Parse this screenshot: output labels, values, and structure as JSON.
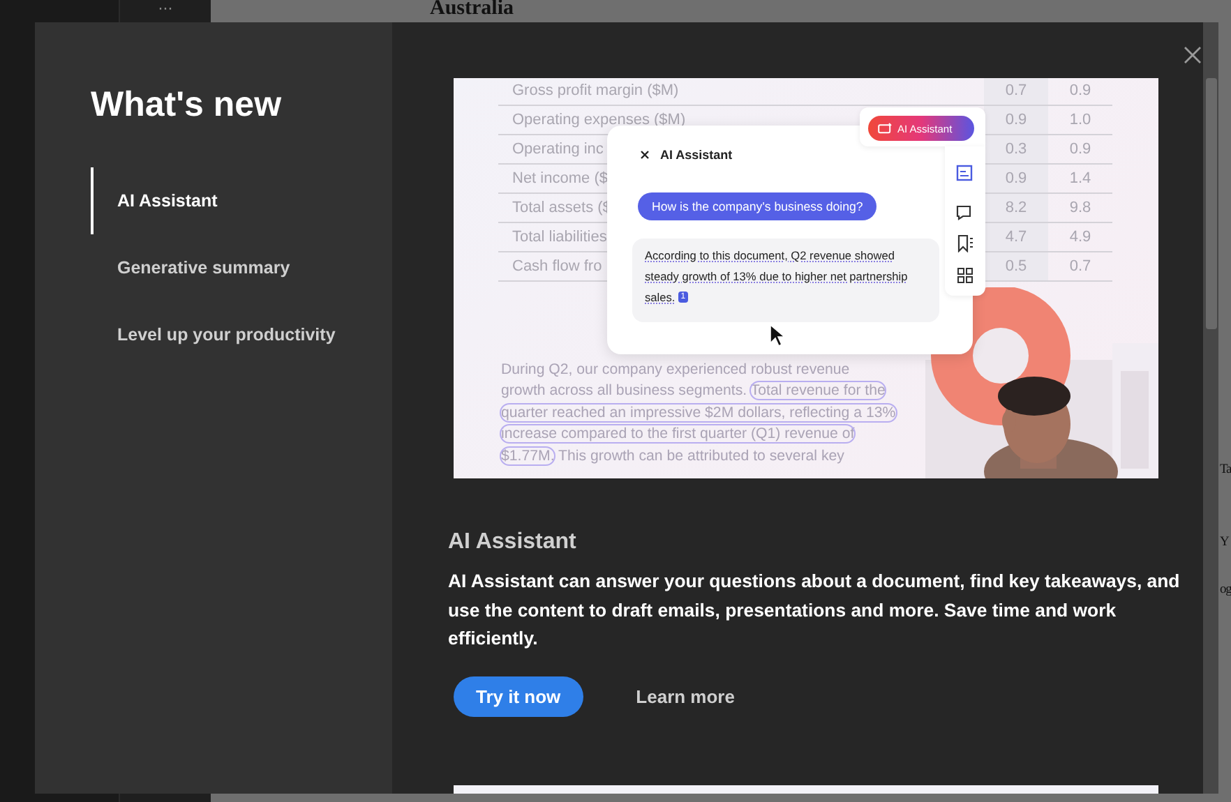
{
  "app": {
    "more_button": "···",
    "document_lines": [
      "Australia"
    ],
    "fragments": [
      "Ta",
      "Y",
      "og"
    ]
  },
  "dialog": {
    "title": "What's new",
    "nav": [
      {
        "label": "AI Assistant",
        "selected": true
      },
      {
        "label": "Generative summary",
        "selected": false
      },
      {
        "label": "Level up your productivity",
        "selected": false
      }
    ],
    "feature": {
      "illustration": {
        "table_rows": [
          {
            "label": "Gross profit margin ($M)",
            "values": [
              "0.7",
              "0.9"
            ]
          },
          {
            "label": "Operating expenses ($M)",
            "values": [
              "0.9",
              "1.0"
            ]
          },
          {
            "label": "Operating inc",
            "values": [
              "0.3",
              "0.9"
            ]
          },
          {
            "label": "Net income ($",
            "values": [
              "0.9",
              "1.4"
            ]
          },
          {
            "label": "Total assets ($",
            "values": [
              "8.2",
              "9.8"
            ]
          },
          {
            "label": "Total liabilities",
            "values": [
              "4.7",
              "4.9"
            ]
          },
          {
            "label": "Cash flow fro",
            "values": [
              "0.5",
              "0.7"
            ]
          }
        ],
        "badge": "AI Assistant",
        "panel_title": "AI Assistant",
        "question": "How is the company's business doing?",
        "answer": "According to this document, Q2 revenue showed steady growth of 13% due to higher net partnership sales.",
        "citation": "1",
        "paragraph": [
          {
            "text": "During Q2, our company experienced robust revenue growth across all business segments.",
            "highlighted": false
          },
          {
            "text": "Total revenue for the quarter reached an impressive $2M dollars, reflecting a 13% increase compared to the first quarter (Q1) revenue of $1.77M.",
            "highlighted": true
          },
          {
            "text": "This growth can be attributed to several key",
            "highlighted": false
          }
        ]
      },
      "heading": "AI Assistant",
      "description": "AI Assistant can answer your questions about a document, find key takeaways, and use the content to draft emails, presentations and more. Save time and work efficiently.",
      "actions": [
        {
          "label": "Try it now",
          "kind": "primary"
        },
        {
          "label": "Learn more",
          "kind": "link"
        }
      ]
    }
  }
}
